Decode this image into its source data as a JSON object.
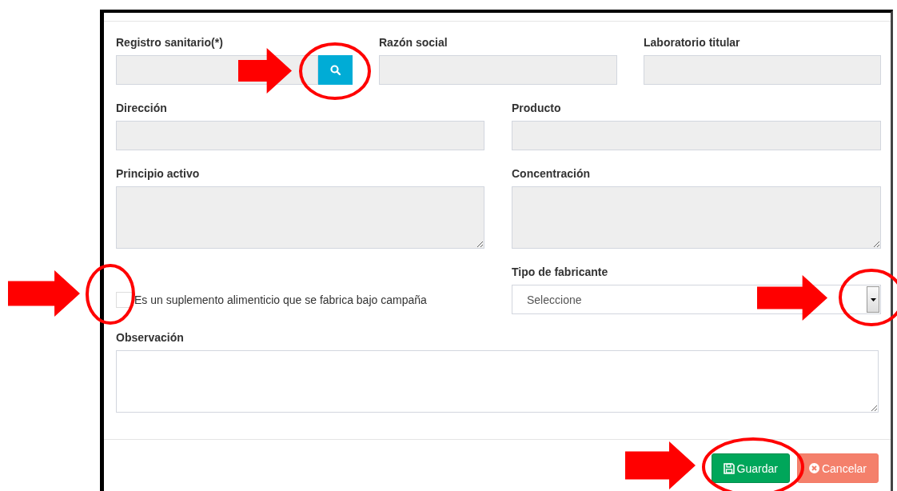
{
  "form": {
    "rows": [
      [
        {
          "kind": "search",
          "label": "Registro sanitario(*)"
        },
        {
          "kind": "text",
          "label": "Razón social"
        },
        {
          "kind": "text",
          "label": "Laboratorio titular"
        }
      ],
      [
        {
          "kind": "text",
          "label": "Dirección"
        },
        {
          "kind": "text",
          "label": "Producto"
        }
      ],
      [
        {
          "kind": "textarea",
          "label": "Principio activo"
        },
        {
          "kind": "textarea",
          "label": "Concentración"
        }
      ],
      [
        {
          "kind": "checkbox",
          "label": "Es un suplemento alimenticio que se fabrica bajo campaña",
          "checked": false
        },
        {
          "kind": "select",
          "label": "Tipo de fabricante",
          "value": "Seleccione"
        }
      ],
      [
        {
          "kind": "note",
          "label": "Observación"
        }
      ]
    ]
  },
  "buttons": [
    {
      "kind": "save",
      "label": "Guardar"
    },
    {
      "kind": "cancel",
      "label": "Cancelar"
    }
  ]
}
